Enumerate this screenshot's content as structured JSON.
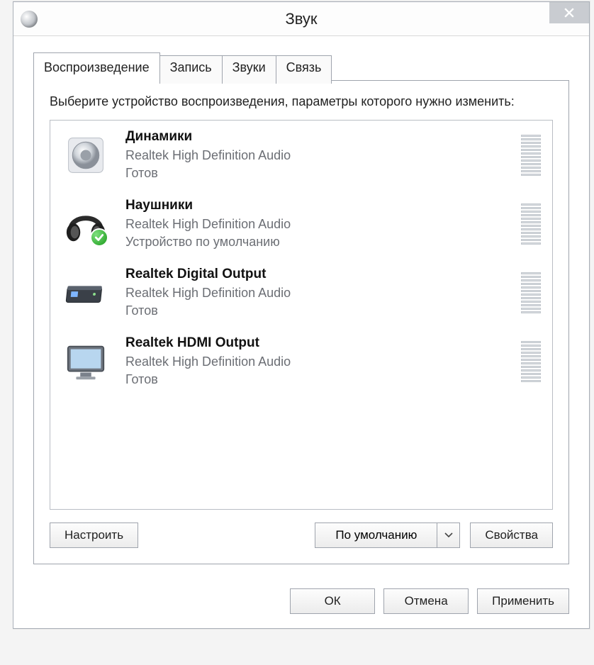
{
  "window": {
    "title": "Звук"
  },
  "tabs": [
    {
      "label": "Воспроизведение",
      "active": true
    },
    {
      "label": "Запись",
      "active": false
    },
    {
      "label": "Звуки",
      "active": false
    },
    {
      "label": "Связь",
      "active": false
    }
  ],
  "instructions": "Выберите устройство воспроизведения, параметры которого нужно изменить:",
  "devices": [
    {
      "icon": "speaker",
      "name": "Динамики",
      "driver": "Realtek High Definition Audio",
      "status": "Готов",
      "default": false
    },
    {
      "icon": "headphones",
      "name": "Наушники",
      "driver": "Realtek High Definition Audio",
      "status": "Устройство по умолчанию",
      "default": true
    },
    {
      "icon": "digital-box",
      "name": "Realtek Digital Output",
      "driver": "Realtek High Definition Audio",
      "status": "Готов",
      "default": false
    },
    {
      "icon": "monitor",
      "name": "Realtek HDMI Output",
      "driver": "Realtek High Definition Audio",
      "status": "Готов",
      "default": false
    }
  ],
  "panel_buttons": {
    "configure": "Настроить",
    "set_default": "По умолчанию",
    "properties": "Свойства"
  },
  "dialog_buttons": {
    "ok": "ОК",
    "cancel": "Отмена",
    "apply": "Применить"
  }
}
